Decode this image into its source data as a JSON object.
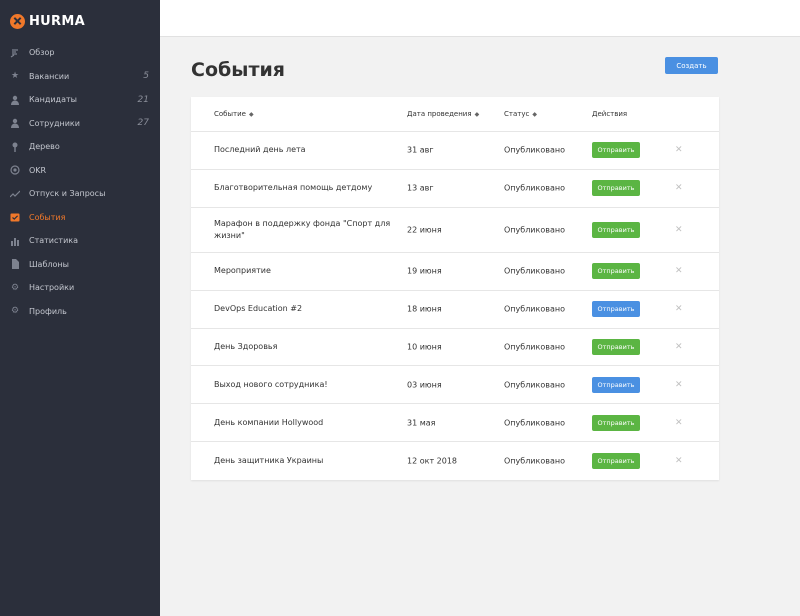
{
  "app": {
    "logo_text": "HURMA",
    "accent_color": "#f0782a",
    "sidebar_color": "#2b2f3b"
  },
  "sidebar": {
    "items": [
      {
        "label": "Обзор",
        "icon": "overview-icon",
        "count": ""
      },
      {
        "label": "Вакансии",
        "icon": "star-icon",
        "count": "5"
      },
      {
        "label": "Кандидаты",
        "icon": "user-icon",
        "count": "21"
      },
      {
        "label": "Сотрудники",
        "icon": "user-icon",
        "count": "27"
      },
      {
        "label": "Дерево",
        "icon": "tree-icon",
        "count": ""
      },
      {
        "label": "OKR",
        "icon": "target-icon",
        "count": ""
      },
      {
        "label": "Отпуск и Запросы",
        "icon": "trend-icon",
        "count": ""
      },
      {
        "label": "События",
        "icon": "calendar-check-icon",
        "count": "",
        "active": true
      },
      {
        "label": "Статистика",
        "icon": "bar-chart-icon",
        "count": ""
      },
      {
        "label": "Шаблоны",
        "icon": "template-icon",
        "count": ""
      },
      {
        "label": "Настройки",
        "icon": "gear-icon",
        "count": ""
      },
      {
        "label": "Профиль",
        "icon": "profile-icon",
        "count": ""
      }
    ]
  },
  "main": {
    "title": "События",
    "create_label": "Создать",
    "create_color": "#4a90e2"
  },
  "table": {
    "columns": [
      "Событие",
      "Дата проведения",
      "Статус",
      "Действия"
    ],
    "rows": [
      {
        "event": "Последний день лета",
        "date": "31 авг",
        "status": "Опубликовано",
        "action": "Отправить",
        "action_color": "green"
      },
      {
        "event": "Благотворительная помощь детдому",
        "date": "13 авг",
        "status": "Опубликовано",
        "action": "Отправить",
        "action_color": "green"
      },
      {
        "event": "Марафон в поддержку фонда \"Спорт для жизни\"",
        "date": "22 июня",
        "status": "Опубликовано",
        "action": "Отправить",
        "action_color": "green"
      },
      {
        "event": "Мероприятие",
        "date": "19 июня",
        "status": "Опубликовано",
        "action": "Отправить",
        "action_color": "green"
      },
      {
        "event": "DevOps Education #2",
        "date": "18 июня",
        "status": "Опубликовано",
        "action": "Отправить",
        "action_color": "blue"
      },
      {
        "event": "День Здоровья",
        "date": "10 июня",
        "status": "Опубликовано",
        "action": "Отправить",
        "action_color": "green"
      },
      {
        "event": "Выход нового сотрудника!",
        "date": "03 июня",
        "status": "Опубликовано",
        "action": "Отправить",
        "action_color": "blue"
      },
      {
        "event": "День компании Hollywood",
        "date": "31 мая",
        "status": "Опубликовано",
        "action": "Отправить",
        "action_color": "green"
      },
      {
        "event": "День защитника Украины",
        "date": "12 окт 2018",
        "status": "Опубликовано",
        "action": "Отправить",
        "action_color": "green"
      }
    ]
  }
}
